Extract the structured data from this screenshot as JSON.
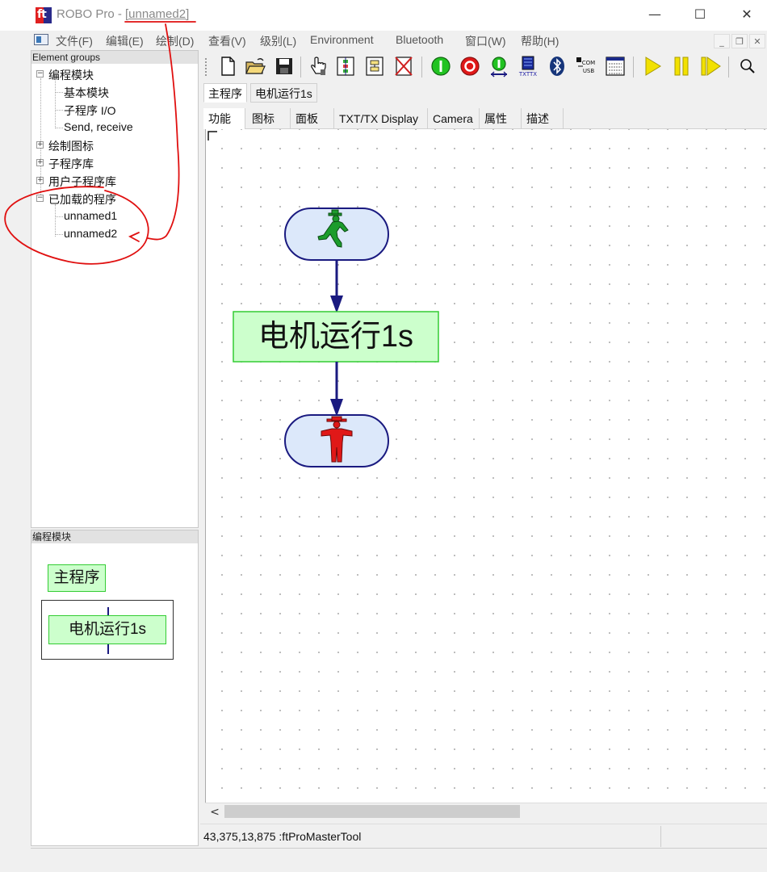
{
  "window": {
    "app_name": "ROBO Pro - ",
    "doc_name": "[unnamed2]",
    "minimize_glyph": "—",
    "maximize_glyph": "☐",
    "close_glyph": "✕"
  },
  "menu": {
    "items": [
      "文件(F)",
      "编辑(E)",
      "绘制(D)",
      "查看(V)",
      "级别(L)",
      "Environment",
      "Bluetooth",
      "窗口(W)",
      "帮助(H)"
    ],
    "mdi_minimize": "_",
    "mdi_restore": "❐",
    "mdi_close": "✕"
  },
  "groups_panel": {
    "header": "Element groups",
    "items": [
      "编程模块",
      "基本模块",
      "子程序 I/O",
      "Send, receive",
      "绘制图标",
      "子程序库",
      "用户子程序库",
      "已加载的程序",
      "unnamed1",
      "unnamed2"
    ]
  },
  "modules_panel": {
    "header": "编程模块",
    "main_program": "主程序",
    "subprogram": "电机运行1s"
  },
  "toolbar": {
    "icons": [
      "new-file-icon",
      "open-folder-icon",
      "save-icon",
      "hand-pointer-icon",
      "subprogram-icon",
      "subprogram-io-icon",
      "delete-icon",
      "start-icon",
      "stop-icon",
      "download-icon",
      "txt-tx-interface-icon",
      "bluetooth-icon",
      "com-usb-icon",
      "test-window-icon",
      "run-icon",
      "pause-icon",
      "step-icon",
      "zoom-icon"
    ],
    "txt_tx_label": "TXTTX",
    "com_label": "COM",
    "usb_label": "USB"
  },
  "program_tabs": [
    "主程序",
    "电机运行1s"
  ],
  "view_tabs": [
    "功能",
    "图标",
    "面板",
    "TXT/TX Display",
    "Camera",
    "属性",
    "描述"
  ],
  "canvas": {
    "motor_block_label": "电机运行1s"
  },
  "scrollbar": {
    "left_arrow": "<"
  },
  "status": {
    "text": "43,375,13,875 :ftProMasterTool"
  },
  "colors": {
    "accent_green": "#ccffcc",
    "accent_green_border": "#33cc33",
    "flow_blue": "#1a1a80",
    "start_end_fill": "#dce8fa",
    "annotation_red": "#e01010"
  }
}
